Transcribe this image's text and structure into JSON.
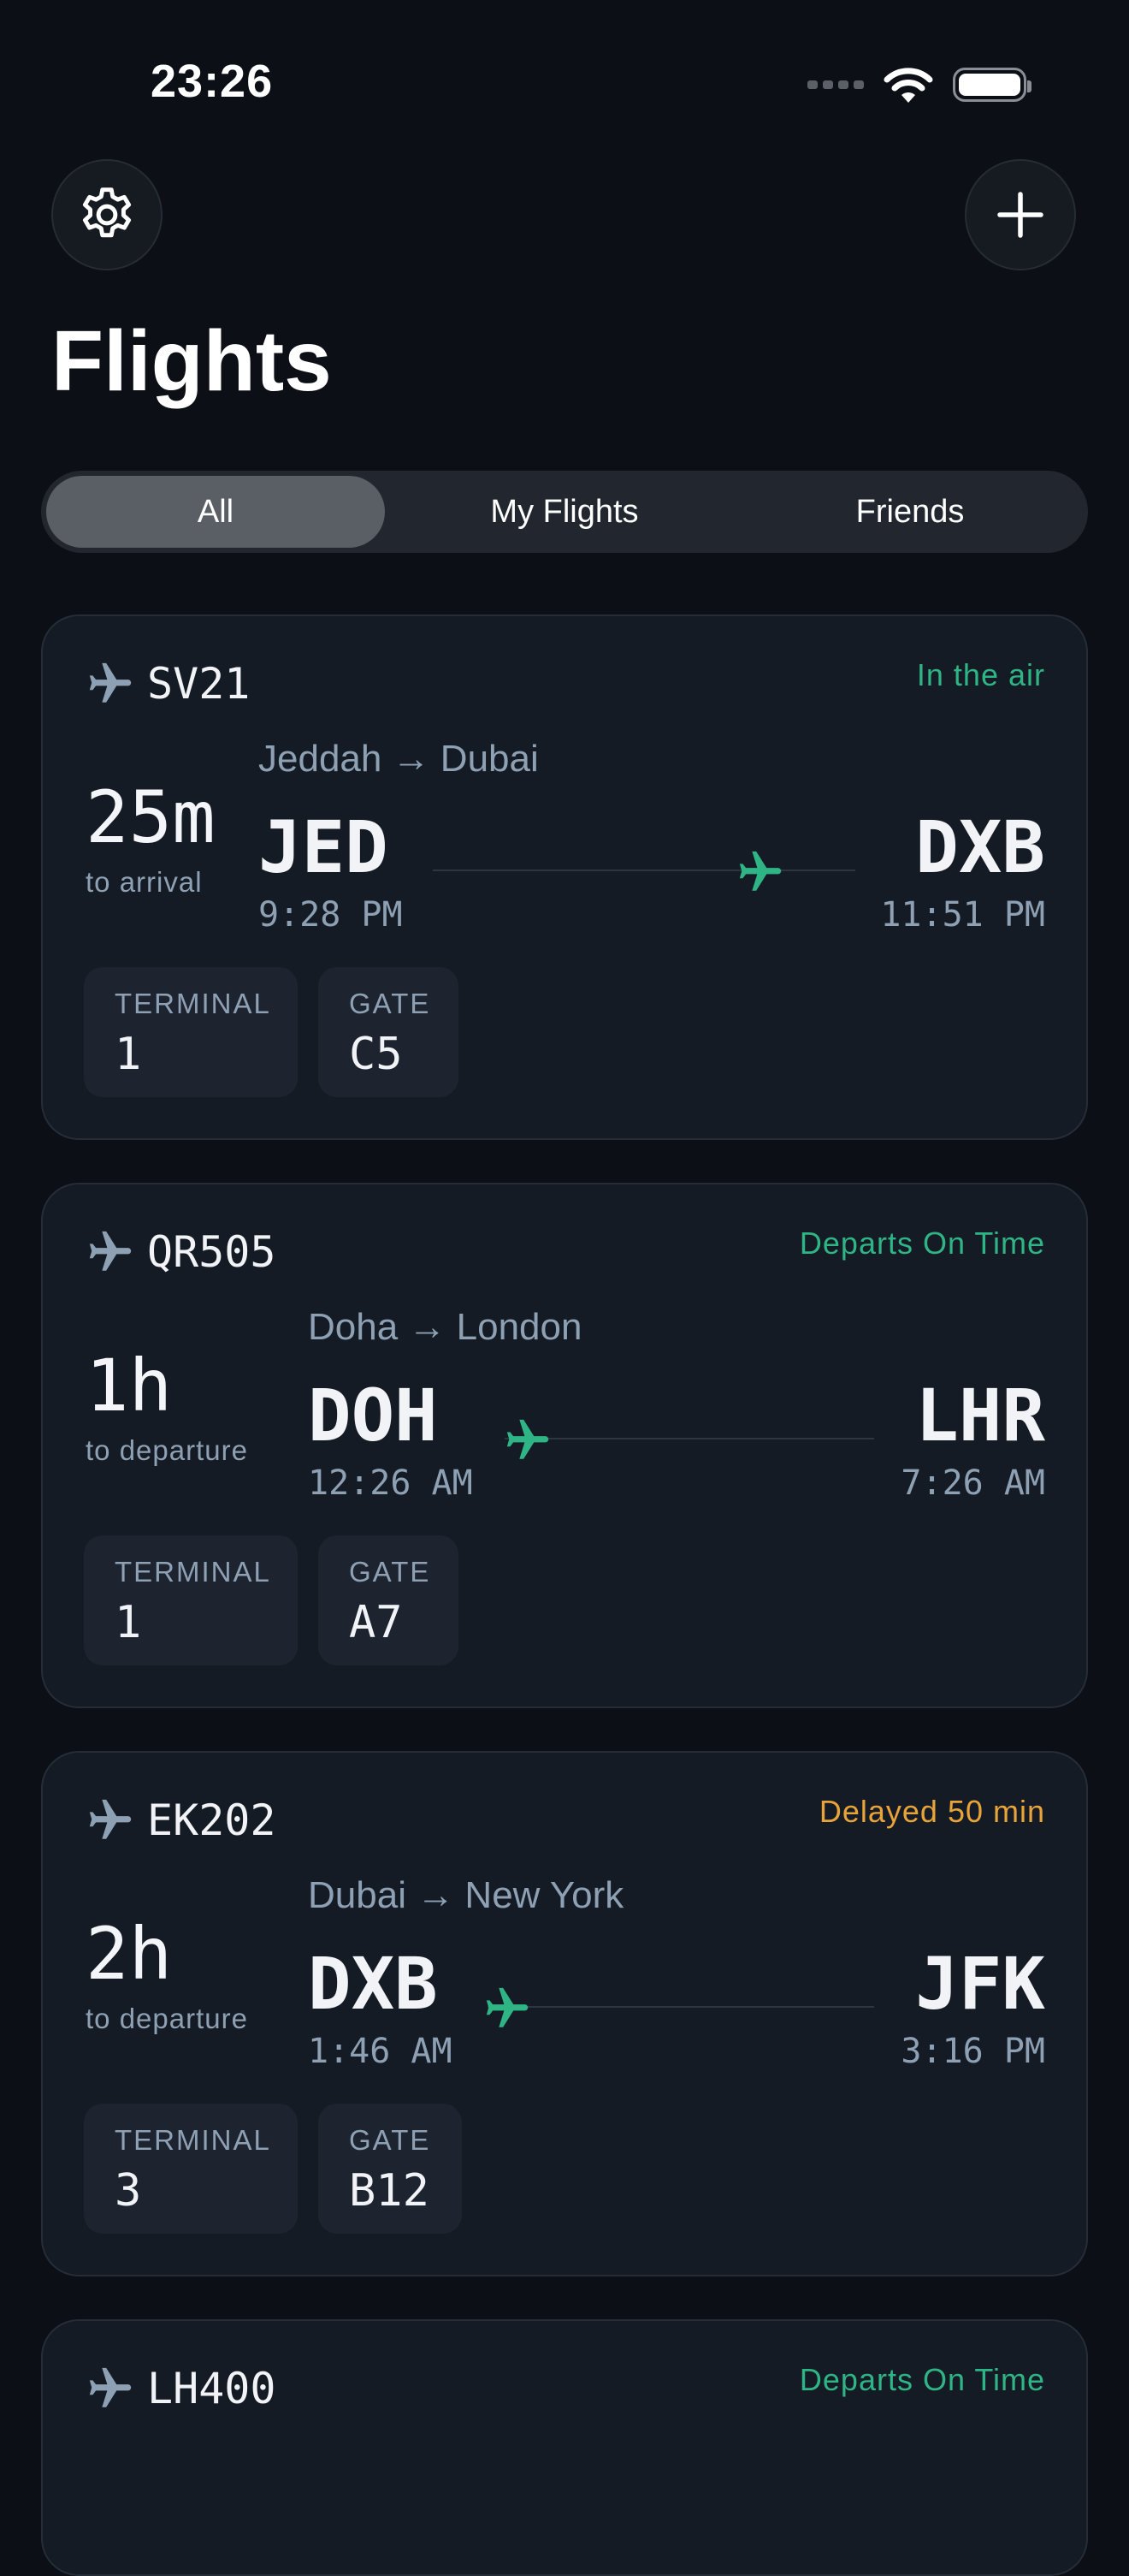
{
  "status_bar": {
    "time": "23:26"
  },
  "header": {
    "title": "Flights"
  },
  "tabs": [
    {
      "label": "All",
      "selected": true
    },
    {
      "label": "My Flights",
      "selected": false
    },
    {
      "label": "Friends",
      "selected": false
    }
  ],
  "flights": [
    {
      "number": "SV21",
      "status": "In the air",
      "status_color": "#2fb585",
      "countdown": "25m",
      "countdown_label": "to arrival",
      "route": "Jeddah → Dubai",
      "dep_code": "JED",
      "arr_code": "DXB",
      "dep_time": "9:28 PM",
      "arr_time": "11:51 PM",
      "terminal_label": "TERMINAL",
      "terminal": "1",
      "gate_label": "GATE",
      "gate": "C5"
    },
    {
      "number": "QR505",
      "status": "Departs On Time",
      "status_color": "#2fb585",
      "countdown": "1h",
      "countdown_label": "to departure",
      "route": "Doha → London",
      "dep_code": "DOH",
      "arr_code": "LHR",
      "dep_time": "12:26 AM",
      "arr_time": "7:26 AM",
      "terminal_label": "TERMINAL",
      "terminal": "1",
      "gate_label": "GATE",
      "gate": "A7"
    },
    {
      "number": "EK202",
      "status": "Delayed 50 min",
      "status_color": "#e8a33a",
      "countdown": "2h",
      "countdown_label": "to departure",
      "route": "Dubai → New York",
      "dep_code": "DXB",
      "arr_code": "JFK",
      "dep_time": "1:46 AM",
      "arr_time": "3:16 PM",
      "terminal_label": "TERMINAL",
      "terminal": "3",
      "gate_label": "GATE",
      "gate": "B12"
    },
    {
      "number": "LH400",
      "status": "Departs On Time",
      "status_color": "#2fb585"
    }
  ]
}
